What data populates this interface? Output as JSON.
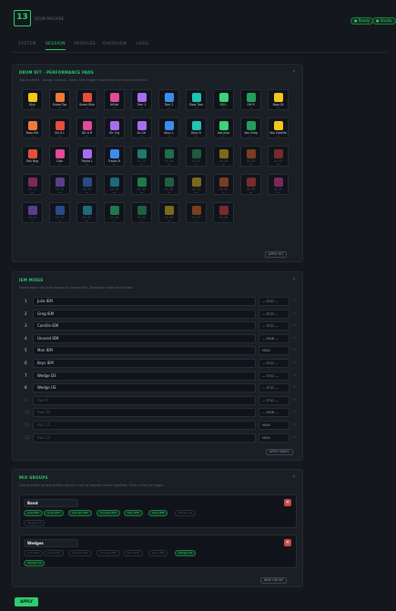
{
  "header": {
    "logo_text": "13",
    "subtitle": "DRUM MACHINE",
    "pills": [
      "● Ready",
      "● Studio"
    ]
  },
  "tabs": [
    "SYSTEM",
    "SESSION",
    "PROFILES",
    "OVERVIEW",
    "LOGS"
  ],
  "active_tab": "SESSION",
  "pads_panel": {
    "title": "DRUM KIT · PERFORMANCE PADS",
    "desc": "Tap to select · assign sounds, colors and trigger modes for each pad in this kit.",
    "apply_label": "APPLY KIT",
    "pads": [
      {
        "label": "Kick",
        "color": "#f5c518"
      },
      {
        "label": "Snare Top",
        "color": "#f07a36"
      },
      {
        "label": "Snare Btm",
        "color": "#e84e3c"
      },
      {
        "label": "HiHat",
        "color": "#e24a9a"
      },
      {
        "label": "Tom 1",
        "color": "#a56ef0"
      },
      {
        "label": "Tom 2",
        "color": "#3c8cf0"
      },
      {
        "label": "Floor Tom",
        "color": "#1fc4b4"
      },
      {
        "label": "OH L",
        "color": "#3ad47a"
      },
      {
        "label": "OH R",
        "color": "#22a05a"
      },
      {
        "label": "Bass DI",
        "color": "#f5c518"
      },
      {
        "label": "Bass Mic",
        "color": "#f07a36"
      },
      {
        "label": "Gtr A L",
        "color": "#e84e3c"
      },
      {
        "label": "Gtr A R",
        "color": "#e24a9a"
      },
      {
        "label": "Gtr Crg",
        "color": "#a56ef0"
      },
      {
        "label": "Ac Gtr",
        "color": "#a56ef0"
      },
      {
        "label": "Keys L",
        "color": "#3c8cf0"
      },
      {
        "label": "Keys R",
        "color": "#1fc4b4"
      },
      {
        "label": "Vox Julia",
        "color": "#3ad47a"
      },
      {
        "label": "Vox Greg",
        "color": "#22a05a"
      },
      {
        "label": "Vox Camille",
        "color": "#f5c518"
      },
      {
        "label": "Talk Bag",
        "color": "#e84e3c"
      },
      {
        "label": "Click",
        "color": "#e24a9a"
      },
      {
        "label": "Tracks L",
        "color": "#a56ef0"
      },
      {
        "label": "Tracks R",
        "color": "#3c8cf0"
      },
      {
        "label": "Ch 25",
        "color": "#1e7a6e",
        "empty": true
      },
      {
        "label": "Ch 26",
        "color": "#1e6e4a",
        "empty": true
      },
      {
        "label": "Ch 27",
        "color": "#1e5a3e",
        "empty": true
      },
      {
        "label": "Ch 28",
        "color": "#7a6a1e",
        "empty": true
      },
      {
        "label": "Ch 29",
        "color": "#7a3e1e",
        "empty": true
      },
      {
        "label": "Ch 30",
        "color": "#7a2a2a",
        "empty": true
      },
      {
        "label": "Ch 31",
        "color": "#7a2a5a",
        "empty": true
      },
      {
        "label": "Ch 32",
        "color": "#5a3e8a",
        "empty": true
      },
      {
        "label": "Ch 33",
        "color": "#2a4a8a",
        "empty": true
      },
      {
        "label": "Ch 34",
        "color": "#1e6a78",
        "empty": true
      },
      {
        "label": "Ch 35",
        "color": "#1e7a4a",
        "empty": true
      },
      {
        "label": "Ch 36",
        "color": "#1e6040",
        "empty": true
      },
      {
        "label": "Ch 37",
        "color": "#7a6a1e",
        "empty": true
      },
      {
        "label": "Ch 38",
        "color": "#7a3e1e",
        "empty": true
      },
      {
        "label": "Ch 39",
        "color": "#7a2a2a",
        "empty": true
      },
      {
        "label": "Ch 40",
        "color": "#7a2a5a",
        "empty": true
      },
      {
        "label": "Ch 41",
        "color": "#5a3e8a",
        "empty": true
      },
      {
        "label": "Ch 42",
        "color": "#2a4a8a",
        "empty": true
      },
      {
        "label": "Ch 43",
        "color": "#1e6a78",
        "empty": true
      },
      {
        "label": "Ch 44",
        "color": "#1e7a4a",
        "empty": true
      },
      {
        "label": "Ch 45",
        "color": "#1e6040",
        "empty": true
      },
      {
        "label": "Ch 46",
        "color": "#7a6a1e",
        "empty": true
      },
      {
        "label": "Ch 47",
        "color": "#7a3e1e",
        "empty": true
      },
      {
        "label": "Ch 48",
        "color": "#7a2a2a",
        "empty": true
      }
    ]
  },
  "mixes_panel": {
    "title": "IEM MIXES",
    "desc": "Name each mix and choose its stereo link. Disabled mixes are hidden.",
    "apply_label": "APPLY MIXES",
    "rows": [
      {
        "num": "1",
        "name": "Julia IEM",
        "mode": "— ST/Cl —"
      },
      {
        "num": "2",
        "name": "Greg IEM",
        "mode": "— ST/Cl —"
      },
      {
        "num": "3",
        "name": "Camille IEM",
        "mode": "— ST/Cl —"
      },
      {
        "num": "4",
        "name": "Unused IEM",
        "mode": "— MAIN —"
      },
      {
        "num": "5",
        "name": "Mon IEM",
        "mode": "MAIN"
      },
      {
        "num": "6",
        "name": "Keys IEM",
        "mode": "— ST/Cl —"
      },
      {
        "num": "7",
        "name": "Wedge DS",
        "mode": "— ST/Cl —"
      },
      {
        "num": "8",
        "name": "Wedge US",
        "mode": "— ST/Cl —"
      },
      {
        "num": "9",
        "name": "Aux 9",
        "mode": "— ST/Cl —",
        "empty": true
      },
      {
        "num": "10",
        "name": "Aux 10",
        "mode": "— MAIN —",
        "empty": true
      },
      {
        "num": "11",
        "name": "Aux 11",
        "mode": "MAIN",
        "empty": true
      },
      {
        "num": "12",
        "name": "Aux 12",
        "mode": "MAIN",
        "empty": true
      }
    ]
  },
  "groups_panel": {
    "title": "MIX GROUPS",
    "desc": "Group mixes so one button sends a cue to several mixes together. Click a chip to toggle.",
    "new_group_label": "NEW GROUP",
    "groups": [
      {
        "name": "Band",
        "chips": [
          {
            "label": "Julia IEM",
            "on": true
          },
          {
            "label": "Greg IEM",
            "on": true
          },
          {
            "label": "Camille IEM",
            "on": true
          },
          {
            "label": "Unused IEM",
            "on": true
          },
          {
            "label": "Mon IEM",
            "on": true
          },
          {
            "label": "Keys IEM",
            "on": true
          },
          {
            "label": "Wedge DS",
            "on": false
          },
          {
            "label": "Wedge US",
            "on": false
          }
        ]
      },
      {
        "name": "Wedges",
        "chips": [
          {
            "label": "Julia IEM",
            "on": false
          },
          {
            "label": "Greg IEM",
            "on": false
          },
          {
            "label": "Camille IEM",
            "on": false
          },
          {
            "label": "Unused IEM",
            "on": false
          },
          {
            "label": "Mon IEM",
            "on": false
          },
          {
            "label": "Keys IEM",
            "on": false
          },
          {
            "label": "Wedge DS",
            "on": true
          },
          {
            "label": "Wedge US",
            "on": true
          }
        ]
      }
    ]
  },
  "footer": {
    "apply_label": "APPLY"
  }
}
